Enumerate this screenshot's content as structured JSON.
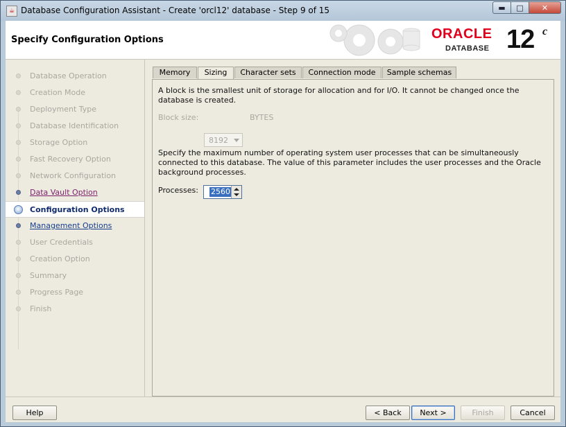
{
  "window": {
    "title": "Database Configuration Assistant - Create 'orcl12' database - Step 9 of 15"
  },
  "header": {
    "title": "Specify Configuration Options",
    "brand": "ORACLE",
    "brand_sub": "DATABASE",
    "version": "12",
    "version_suffix": "c"
  },
  "steps": [
    "Database Operation",
    "Creation Mode",
    "Deployment Type",
    "Database Identification",
    "Storage Option",
    "Fast Recovery Option",
    "Network Configuration",
    "Data Vault Option",
    "Configuration Options",
    "Management Options",
    "User Credentials",
    "Creation Option",
    "Summary",
    "Progress Page",
    "Finish"
  ],
  "tabs": {
    "memory": "Memory",
    "sizing": "Sizing",
    "charsets": "Character sets",
    "connection": "Connection mode",
    "schemas": "Sample schemas"
  },
  "sizing": {
    "block_desc": "A block is the smallest unit of storage for allocation and for I/O. It cannot be changed once the database is created.",
    "block_label": "Block size:",
    "block_value": "8192",
    "block_unit": "BYTES",
    "proc_desc": "Specify the maximum number of operating system user processes that can be simultaneously connected to this database. The value of this parameter includes the user processes and the Oracle background processes.",
    "proc_label": "Processes:",
    "proc_value": "2560"
  },
  "buttons": {
    "help": "Help",
    "back": "< Back",
    "next": "Next >",
    "finish": "Finish",
    "cancel": "Cancel"
  }
}
